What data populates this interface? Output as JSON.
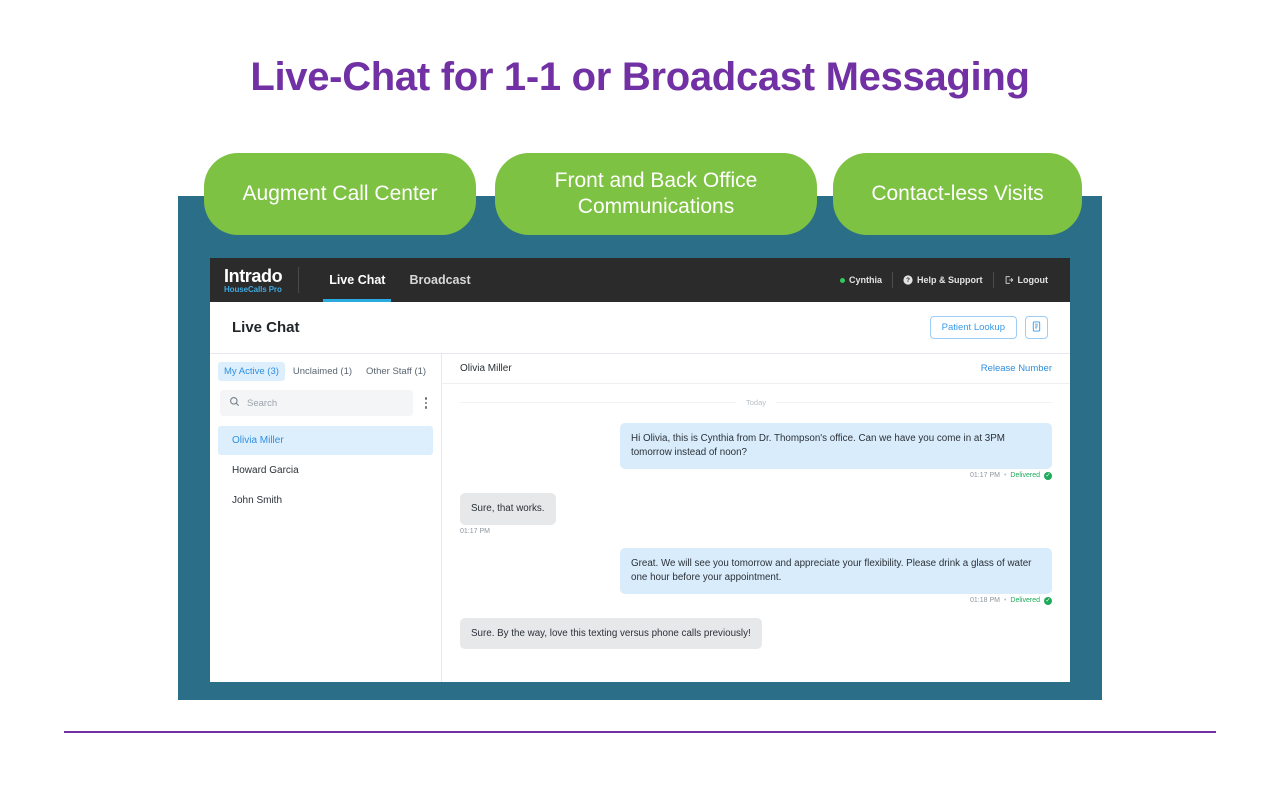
{
  "slide": {
    "title": "Live-Chat for 1-1 or Broadcast Messaging",
    "accent_purple": "#7130A3",
    "frame_teal": "#2B6E88",
    "pill_green": "#7DC242",
    "pills": [
      {
        "label": "Augment Call Center"
      },
      {
        "label": "Front and Back Office Communications"
      },
      {
        "label": "Contact-less Visits"
      }
    ]
  },
  "app": {
    "nav": {
      "brand_name": "Intrado",
      "brand_sub": "HouseCalls Pro",
      "tabs": [
        {
          "label": "Live Chat",
          "active": true
        },
        {
          "label": "Broadcast",
          "active": false
        }
      ],
      "user": "Cynthia",
      "help": "Help & Support",
      "logout": "Logout",
      "status_dot_color": "#35C759",
      "active_underline_color": "#29ABE2"
    },
    "page": {
      "title": "Live Chat",
      "patient_lookup_label": "Patient Lookup",
      "notes_icon": "document-list-icon"
    },
    "sidebar": {
      "tabs": [
        {
          "label": "My Active (3)",
          "active": true
        },
        {
          "label": "Unclaimed (1)",
          "active": false
        },
        {
          "label": "Other Staff (1)",
          "active": false
        }
      ],
      "search_placeholder": "Search",
      "search_value": "",
      "contacts": [
        {
          "name": "Olivia Miller",
          "active": true
        },
        {
          "name": "Howard Garcia",
          "active": false
        },
        {
          "name": "John Smith",
          "active": false
        }
      ]
    },
    "chat": {
      "contact_name": "Olivia Miller",
      "release_label": "Release Number",
      "day_label": "Today",
      "messages": [
        {
          "direction": "out",
          "text": "Hi Olivia, this is Cynthia from Dr. Thompson's office. Can we have you come in at 3PM tomorrow instead of noon?",
          "time": "01:17 PM",
          "status": "Delivered"
        },
        {
          "direction": "in",
          "text": "Sure, that works.",
          "time": "01:17 PM",
          "status": ""
        },
        {
          "direction": "out",
          "text": "Great. We will see you tomorrow and appreciate your flexibility. Please drink a glass of water one hour before your appointment.",
          "time": "01:18 PM",
          "status": "Delivered"
        },
        {
          "direction": "in",
          "text": "Sure. By the way, love this texting versus phone calls previously!",
          "time": "",
          "status": ""
        }
      ]
    }
  }
}
